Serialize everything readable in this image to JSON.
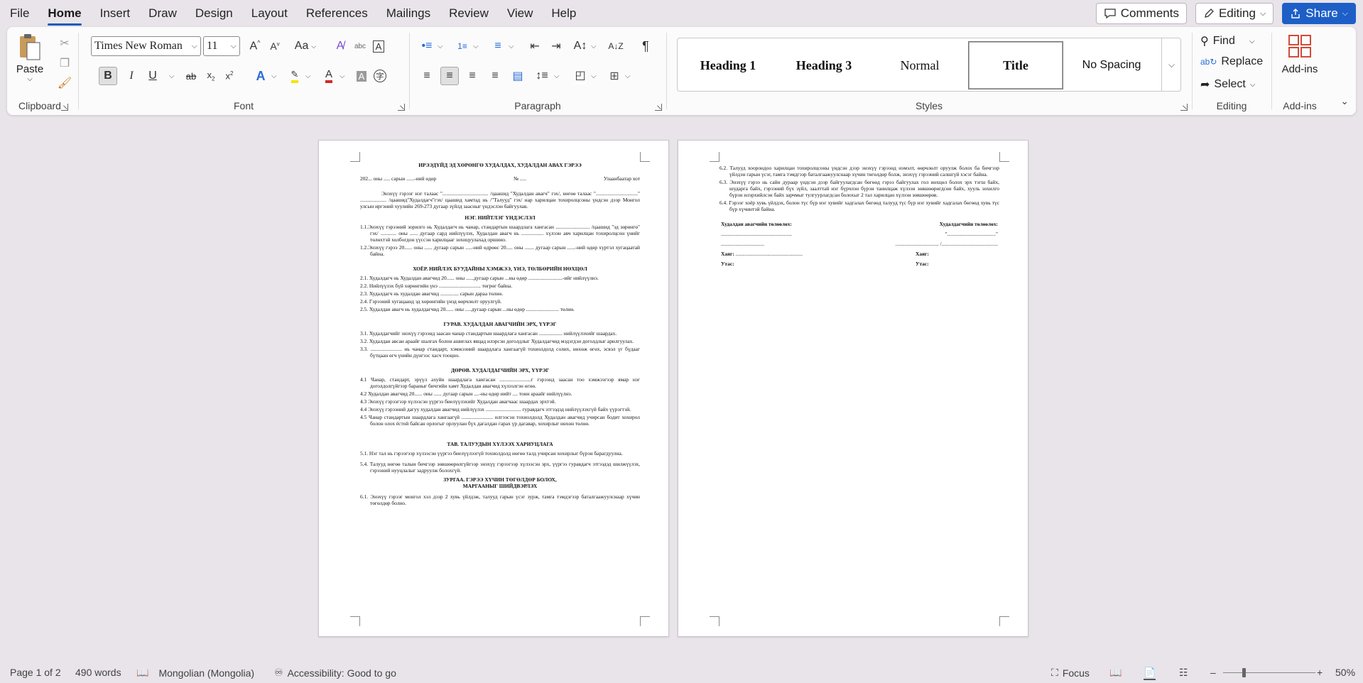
{
  "menu": {
    "items": [
      "File",
      "Home",
      "Insert",
      "Draw",
      "Design",
      "Layout",
      "References",
      "Mailings",
      "Review",
      "View",
      "Help"
    ],
    "active": "Home"
  },
  "top_right": {
    "comments": "Comments",
    "editing": "Editing",
    "share": "Share"
  },
  "ribbon": {
    "clipboard": {
      "label": "Clipboard",
      "paste": "Paste"
    },
    "font": {
      "label": "Font",
      "font_name": "Times New Roman",
      "font_size": "11",
      "change_case": "Aa"
    },
    "paragraph": {
      "label": "Paragraph"
    },
    "styles": {
      "label": "Styles",
      "items": [
        "Heading 1",
        "Heading 3",
        "Normal",
        "Title",
        "No Spacing"
      ],
      "selected": "Title"
    },
    "editing": {
      "label": "Editing",
      "find": "Find",
      "replace": "Replace",
      "select": "Select"
    },
    "addins": {
      "label": "Add-ins",
      "button": "Add-ins"
    }
  },
  "document": {
    "page1": {
      "title": "ИРЭЭДҮЙД ЭД ХӨРӨНГӨ ХУДАЛДАХ, ХУДАЛДАН АВАХ ГЭРЭЭ",
      "date_line": "202... оны ..... сарын ......-ний өдөр",
      "number": "№ .....",
      "city": "Улаанбаатар хот",
      "intro": "Энэхүү гэрээг нэг талаас \"................................... /цаашид \"Худалдан авагч\" гэх/, нөгөө талаас \"................................\" .................... /цаашид\"Худалдагч\"гэх/ цаашид хамтад нь /\"Талууд\" гэх/ нар харилцан тохиролцсоны үндсэн дээр Монгол улсын иргэний хуулийн 269-273 дугаар зүйлд заасныг үндэслэн байгуулав.",
      "s1": "НЭГ. НИЙТЛЭГ ҮНДЭСЛЭЛ",
      "p1_1": "1.1.Энэхүү гэрээний зорилго нь Худалдагч нь чанар, стандартын шаардлага хангасан .......................... /цаашид \"эд зөрөнгө\" гэх/ ............ оны ...... дугаар сард нийлүүлэх, Худалдан авагч нь ................. хүлээн авч харилцан тохиролцсон үнийг төлөхтэй холбогдон үүссэн харилцааг зохицуулахад оршино.",
      "p1_2": "1.2.Энэхүү гэрээ 20...... оны ...... дугаар сарын .....-ний өдрөөс 20..... оны ....... дугаар сарын ......-ний өдөр хүртэл хугацаатай байна.",
      "s2": "ХОЁР. НИЙЛЭХ БУУДАЙНЫ ХЭМЖЭЭ, ҮНЭ, ТӨЛБӨРИЙН НӨХЦӨЛ",
      "p2_1": "2.1. Худалдагч нь Худалдан авагчид 20...... оны ......дугаар сарын ...ны өдөр ..........................-ийг нийлүүлнэ.",
      "p2_2": "2.2. Нийлүүлэх бүй хөрөнгийн үнэ ................................ төгрөг байна.",
      "p2_3": "2.3. Худалдагч нь худалдан авагчид .............. сарын дараа төлнө.",
      "p2_4": "2.4. Гэрээний хугацаанд эд хөрөнгийн үнэд өөрчлөлт оруулгүй.",
      "p2_5": "2.5. Худалдан авагч нь худалдагчид 20...... оны .....дугаар сарын ...ны өдөр ......................... төлнө.",
      "s3": "ГУРАВ. ХУДАЛДАН АВАГЧИЙН ЭРХ, ҮҮРЭГ",
      "p3_1": "3.1. Худалдагчийг энэхүү гэрээнд заасан чанар стандартын шаардлага хангасан .................. нийлүүлэхийг шаардах.",
      "p3_2": "3.2. Худалдан авсан араайг шалгах болон ашиглах явцад илэрсэн доголдлыг Худалдагчид мэдэгдэн доголдлыг арилгуулах.",
      "p3_3": "3.3. ........................ нь чанар стандарт, хэмжээний шаардлага хангаагүй тохиолдолд солих, нөхөж өгөх, эсвэл үг бүдааг бүтцаан өгч үнийн дүнгээс хасч тооцно.",
      "s4": "ДӨРӨВ. ХУДАЛДАГЧИЙН ЭРХ, ҮҮРЭГ",
      "p4_1": "4.1 Чанар, стандарт, эрүүл ахуйн шаардлага хангасан ........................г гэрээнд заасан тоо хэмжээгээр ямар нэг доголдолгүйгээр бараныг бичгийн хамт Худалдан авагчид хүлээлгэн өгнө.",
      "p4_2": "4.2 Худалдан авагчид 20...... оны ...... дугаар сарын ....-ны өдөр нийт .... тонн араайг нийлүүлнэ.",
      "p4_3": "4.3 Энэхүү гэрээгээр хүлээсэн үүргээ биелүүлэхийг Худалдан авагчаас шаардах эрхтэй.",
      "p4_4": "4.4 Энэхүү гэрээний дагуу худалдан авагчид нийлүүлэх ........................... гуравдагч этгээдэд нийлүүлэхгүй байх үүрэгтэй.",
      "p4_5": "4.5 Чанар стандартын шаардлага хангаагүй ........................ илгээсэн тохиолдолд Худалдан авагчид учирсан бодит хохирол болон олох ёстой байсан орлогыг орлуулан бүх дагалдан гарах үр дагавар, хохирлыг нөхөн төлнө.",
      "s5": "ТАВ. ТАЛУУДЫН ХҮЛЭЭХ ХАРИУЦЛАГА",
      "p5_1": "5.1. Нэг тал нь гэрээгээр хүлээсэн үүргээ биелүүлээгүй тохиолдолд нөгөө талд учирсан хохирлыг бүрэн барагдуулна.",
      "p5_4": "5.4. Талууд нөгөө талын бичгээр зөвшөөрөлгүйгээр энэхүү гэрээгээр хүлээсэн эрх, үүргээ гуравдагч этгээдэд шилжүүлэх, гэрээний нууцлалыг задруулж болохгүй.",
      "s6a": "ЗУРГАА. ГЭРЭЭ ХҮЧИН ТӨГӨЛДӨР БОЛОХ,",
      "s6b": "МАРГААНЫГ ШИЙДВЭРЛЭХ",
      "p6_1": "6.1. Энэхүү гэрээг монгол хэл дээр 2 хувь үйлдэж, талууд гарын үсэг зурж, тамга тэмдэгээр баталгаажуулснаар хүчин төгөлдөр болно."
    },
    "page2": {
      "p6_2": "6.2. Талууд хоорондоо харилцан тохиролцсоны үндсэн дээр энэхүү гэрээнд нэмэлт, өөрчлөлт оруулж болох ба бичгээр үйлдэн гарын үсэг, тамга тэмдгээр баталгаажуулснаар хүчин төгөлдөр болж, энэхүү гэрээний салшгүй хэсэг байна.",
      "p6_3": "6.3. Энэхүү гэрээ нь сайн дураар үндсэн дээр байгуулагдсан бөгөөд гэрээ байгуулах гол нөхцөл болох эрх тэгш байх, шударга байх, гэрээний бүх зүйл, заалттай нэг бүрчлэн бүрэн танилцаж хүлээн зөвшөөрөгдсөн байх, хууль зохилго бүрэн илэрхийлсэн байх зарчмыг тулгуурлагдсан болохыг 2 тал харилцан хүлээн зөвшөөрөв.",
      "p6_4": "6.4. Гэрээг хоёр хувь үйлдэх, болон түс бүр нэг хувийг хадгалах бөгөөд талууд түс бүр нэг хувийг хадгалах бөгөөд хувь түс бүр хүчинтэй байна.",
      "sig_buyer_title": "Худалдан авагчийн төлөөлөх:",
      "sig_seller_title": "Худалдагчийн төлөөлөх:",
      "sig_buyer_line": "......................................................",
      "sig_seller_line": "\".....................................\"",
      "sig_buyer_line2": ".................................",
      "sig_seller_line2": "................................. /...........................................",
      "address_label": "Хаяг:",
      "address_dots": "...................................................",
      "phone_label": "Утас:"
    }
  },
  "status": {
    "page": "Page 1 of 2",
    "words": "490 words",
    "language": "Mongolian (Mongolia)",
    "accessibility": "Accessibility: Good to go",
    "focus": "Focus",
    "zoom": "50%"
  }
}
